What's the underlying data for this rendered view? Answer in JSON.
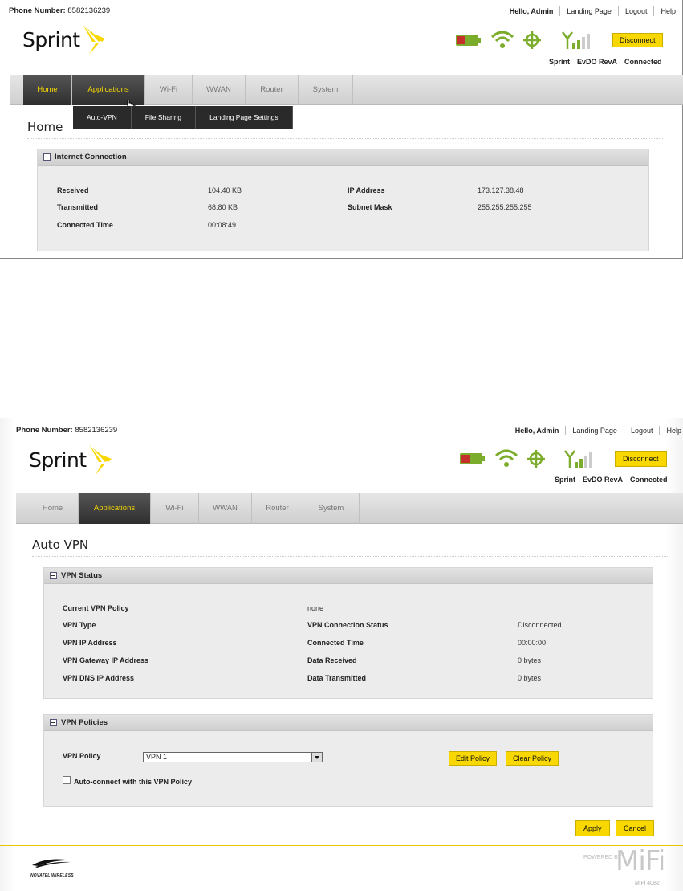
{
  "header": {
    "phone_label": "Phone Number:",
    "phone_number": "8582136239",
    "links": [
      "Hello, Admin",
      "Landing Page",
      "Logout",
      "Help"
    ],
    "logo": "Sprint",
    "disconnect": "Disconnect",
    "status": [
      "Sprint",
      "EvDO RevA",
      "Connected"
    ]
  },
  "nav": {
    "tabs": [
      "Home",
      "Applications",
      "Wi-Fi",
      "WWAN",
      "Router",
      "System"
    ]
  },
  "screen1": {
    "submenu": [
      "Auto-VPN",
      "File Sharing",
      "Landing Page Settings"
    ],
    "page_title": "Home",
    "panel_title": "Internet Connection",
    "rows": {
      "received_label": "Received",
      "received_value": "104.40 KB",
      "transmitted_label": "Transmitted",
      "transmitted_value": "68.80 KB",
      "connected_time_label": "Connected Time",
      "connected_time_value": "00:08:49",
      "ip_label": "IP Address",
      "ip_value": "173.127.38.48",
      "subnet_label": "Subnet Mask",
      "subnet_value": "255.255.255.255"
    }
  },
  "screen2": {
    "page_title": "Auto VPN",
    "status_panel": {
      "title": "VPN Status",
      "current_policy_label": "Current VPN Policy",
      "current_policy_value": "none",
      "vpn_type_label": "VPN Type",
      "conn_status_label": "VPN Connection Status",
      "conn_status_value": "Disconnected",
      "vpn_ip_label": "VPN IP Address",
      "connected_time_label": "Connected Time",
      "connected_time_value": "00:00:00",
      "gateway_label": "VPN Gateway IP Address",
      "data_received_label": "Data Received",
      "data_received_value": "0 bytes",
      "dns_label": "VPN DNS IP Address",
      "data_transmitted_label": "Data Transmitted",
      "data_transmitted_value": "0 bytes"
    },
    "policies_panel": {
      "title": "VPN Policies",
      "policy_label": "VPN Policy",
      "policy_selected": "VPN 1",
      "edit_button": "Edit Policy",
      "clear_button": "Clear Policy",
      "autoconnect_label": "Auto-connect with this VPN Policy"
    },
    "apply_button": "Apply",
    "cancel_button": "Cancel",
    "footer": {
      "novatel": "NOVATEL WIRELESS",
      "powered_by": "POWERED BY",
      "mifi": "MiFi",
      "model": "MiFi 4082"
    }
  },
  "colors": {
    "accent": "#f8d800",
    "nav_active": "#333333",
    "green_icon": "#7cac2b"
  }
}
